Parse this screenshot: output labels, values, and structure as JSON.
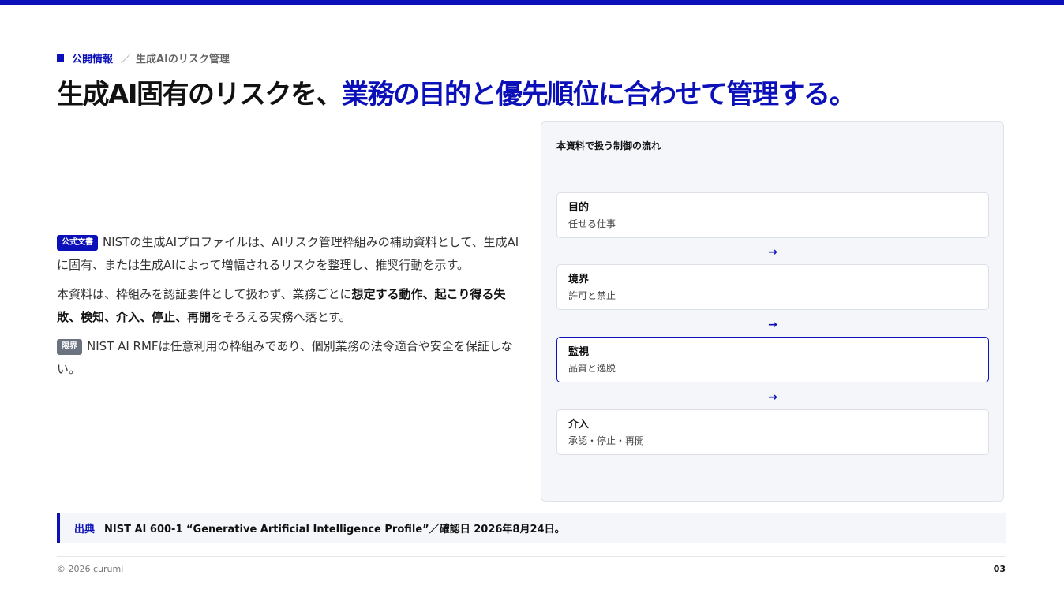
{
  "breadcrumb": {
    "section": "公開情報",
    "separator": "／",
    "topic": "生成AIのリスク管理"
  },
  "title": {
    "plain": "生成AI固有のリスクを、",
    "highlight": "業務の目的と優先順位に合わせて管理する。"
  },
  "body": {
    "p1": {
      "tag": "公式文書",
      "text": "NISTの生成AIプロファイルは、AIリスク管理枠組みの補助資料として、生成AIに固有、または生成AIによって増幅されるリスクを整理し、推奨行動を示す。"
    },
    "p2": {
      "pre": "本資料は、枠組みを認証要件として扱わず、業務ごとに",
      "bold": "想定する動作、起こり得る失敗、検知、介入、停止、再開",
      "post": "をそろえる実務へ落とす。"
    },
    "p3": {
      "tag": "限界",
      "text": "NIST AI RMFは任意利用の枠組みであり、個別業務の法令適合や安全を保証しない。"
    }
  },
  "flow": {
    "title": "本資料で扱う制御の流れ",
    "arrow": "→",
    "steps": [
      {
        "name": "目的",
        "desc": "任せる仕事"
      },
      {
        "name": "境界",
        "desc": "許可と禁止"
      },
      {
        "name": "監視",
        "desc": "品質と逸脱"
      },
      {
        "name": "介入",
        "desc": "承認・停止・再開"
      }
    ]
  },
  "source": {
    "label": "出典",
    "text": "NIST AI 600-1 “Generative Artificial Intelligence Profile”／確認日 2026年8月24日。"
  },
  "footer": {
    "copyright": "© 2026 curumi",
    "page": "03"
  }
}
